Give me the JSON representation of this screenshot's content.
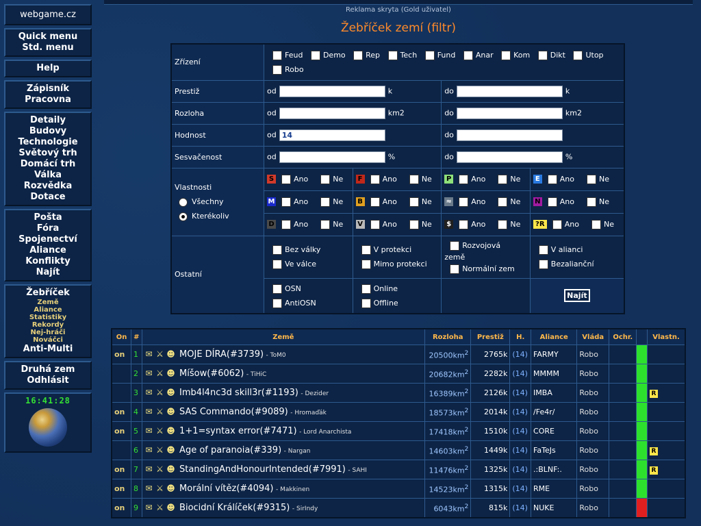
{
  "sidebar": {
    "site": "webgame.cz",
    "groups": [
      [
        "Quick menu",
        "Std. menu"
      ],
      [
        "Help"
      ],
      [
        "Zápisník",
        "Pracovna"
      ],
      [
        "Detaily",
        "Budovy",
        "Technologie",
        "Světový trh",
        "Domácí trh",
        "Válka",
        "Rozvědka",
        "Dotace"
      ],
      [
        "Pošta",
        "Fóra",
        "Spojenectví",
        "Aliance",
        "Konflikty",
        "Najít"
      ]
    ],
    "ladder": "Žebříček",
    "ladder_sub": [
      "Země",
      "Aliance",
      "Statistiky",
      "Rekordy",
      "Nej-hráči",
      "Nováčci"
    ],
    "anti_multi": "Anti-Multi",
    "bottom": [
      "Druhá zem",
      "Odhlásit"
    ],
    "clock": "16:41:28"
  },
  "ad": "Reklama skryta (Gold uživatel)",
  "title": "Žebříček zemí (filtr)",
  "filter": {
    "zrizeni_label": "Zřízení",
    "zrizeni": [
      "Feud",
      "Demo",
      "Rep",
      "Tech",
      "Fund",
      "Anar",
      "Kom",
      "Dikt",
      "Utop",
      "Robo"
    ],
    "prestiz_label": "Prestiž",
    "rozloha_label": "Rozloha",
    "hodnost_label": "Hodnost",
    "sesvacenost_label": "Sesvačenost",
    "od": "od",
    "do": "do",
    "unit_k": "k",
    "unit_km2": "km2",
    "unit_pct": "%",
    "hodnost_od_value": "14",
    "vlastnosti_label": "Vlastnosti",
    "vsechny": "Všechny",
    "kterekoliv": "Kterékoliv",
    "ano": "Ano",
    "ne": "Ne",
    "badges": [
      {
        "t": "S",
        "bg": "#d23a2a",
        "c": "#000"
      },
      {
        "t": "F",
        "bg": "#c0281a",
        "c": "#000"
      },
      {
        "t": "P",
        "bg": "#8ee07a",
        "c": "#000"
      },
      {
        "t": "E",
        "bg": "#2a7ae0",
        "c": "#fff"
      },
      {
        "t": "M",
        "bg": "#1a2acc",
        "c": "#fff"
      },
      {
        "t": "B",
        "bg": "#e0a020",
        "c": "#000"
      },
      {
        "t": "≈",
        "bg": "#6a7a8a",
        "c": "#fff"
      },
      {
        "t": "N",
        "bg": "#a01aa0",
        "c": "#000"
      },
      {
        "t": "D",
        "bg": "#4a4a4a",
        "c": "#000"
      },
      {
        "t": "V",
        "bg": "#b8b8b8",
        "c": "#000"
      },
      {
        "t": "$",
        "bg": "#202020",
        "c": "#fff"
      },
      {
        "t": "?R",
        "bg": "#ffe64a",
        "c": "#000"
      }
    ],
    "ostatni_label": "Ostatní",
    "ostatni": {
      "bez_valky": "Bez války",
      "ve_valce": "Ve válce",
      "v_protekci": "V protekci",
      "mimo_protekci": "Mimo protekci",
      "rozvojova": "Rozvojová",
      "zeme": "země",
      "normalni_zem": "Normální zem",
      "v_alianci": "V alianci",
      "bezaliancni": "Bezalianční",
      "osn": "OSN",
      "antiosn": "AntiOSN",
      "online": "Online",
      "offline": "Offline"
    },
    "submit": "Najít"
  },
  "results": {
    "headers": [
      "On",
      "#",
      "Země",
      "Rozloha",
      "Prestiž",
      "H.",
      "Aliance",
      "Vláda",
      "Ochr.",
      "",
      "Vlastn."
    ],
    "rows": [
      {
        "on": "on",
        "n": "1",
        "name": "MOJE DÍRA(#3739)",
        "ruler": "- ToM0",
        "area": "20500km",
        "prestige": "2765k",
        "rank": "(14)",
        "alliance": "FARMY",
        "gov": "Robo",
        "bar": "green",
        "badge": ""
      },
      {
        "on": "",
        "n": "2",
        "name": "Míšow(#6062)",
        "ruler": "- TiHiC",
        "area": "20682km",
        "prestige": "2282k",
        "rank": "(14)",
        "alliance": "MMMM",
        "gov": "Robo",
        "bar": "green",
        "badge": ""
      },
      {
        "on": "",
        "n": "3",
        "name": "Imb4l4nc3d skill3r(#1193)",
        "ruler": "- Dezider",
        "area": "16389km",
        "prestige": "2126k",
        "rank": "(14)",
        "alliance": "IMBA",
        "gov": "Robo",
        "bar": "green",
        "badge": "R"
      },
      {
        "on": "on",
        "n": "4",
        "name": "SAS Commando(#9089)",
        "ruler": "- Hromaďák",
        "area": "18573km",
        "prestige": "2014k",
        "rank": "(14)",
        "alliance": "/Fe4r/",
        "gov": "Robo",
        "bar": "green",
        "badge": ""
      },
      {
        "on": "on",
        "n": "5",
        "name": "1+1=syntax error(#7471)",
        "ruler": "- Lord Anarchista",
        "area": "17418km",
        "prestige": "1510k",
        "rank": "(14)",
        "alliance": "CORE",
        "gov": "Robo",
        "bar": "green",
        "badge": ""
      },
      {
        "on": "",
        "n": "6",
        "name": "Age of paranoia(#339)",
        "ruler": "- Nargan",
        "area": "14603km",
        "prestige": "1449k",
        "rank": "(14)",
        "alliance": "FaTeJs",
        "gov": "Robo",
        "bar": "green",
        "badge": "R"
      },
      {
        "on": "on",
        "n": "7",
        "name": "StandingAndHonourIntended(#7991)",
        "ruler": "- SAHI",
        "area": "11476km",
        "prestige": "1325k",
        "rank": "(14)",
        "alliance": ".:BLNF:.",
        "gov": "Robo",
        "bar": "green",
        "badge": "R"
      },
      {
        "on": "on",
        "n": "8",
        "name": "Morální vítěz(#4094)",
        "ruler": "- Makkinen",
        "area": "14523km",
        "prestige": "1315k",
        "rank": "(14)",
        "alliance": "RME",
        "gov": "Robo",
        "bar": "green",
        "badge": ""
      },
      {
        "on": "on",
        "n": "9",
        "name": "Biocidní Králíček(#9315)",
        "ruler": "- SirIndy",
        "area": "6043km",
        "prestige": "815k",
        "rank": "(14)",
        "alliance": "NUKE",
        "gov": "Robo",
        "bar": "red",
        "badge": ""
      }
    ]
  }
}
